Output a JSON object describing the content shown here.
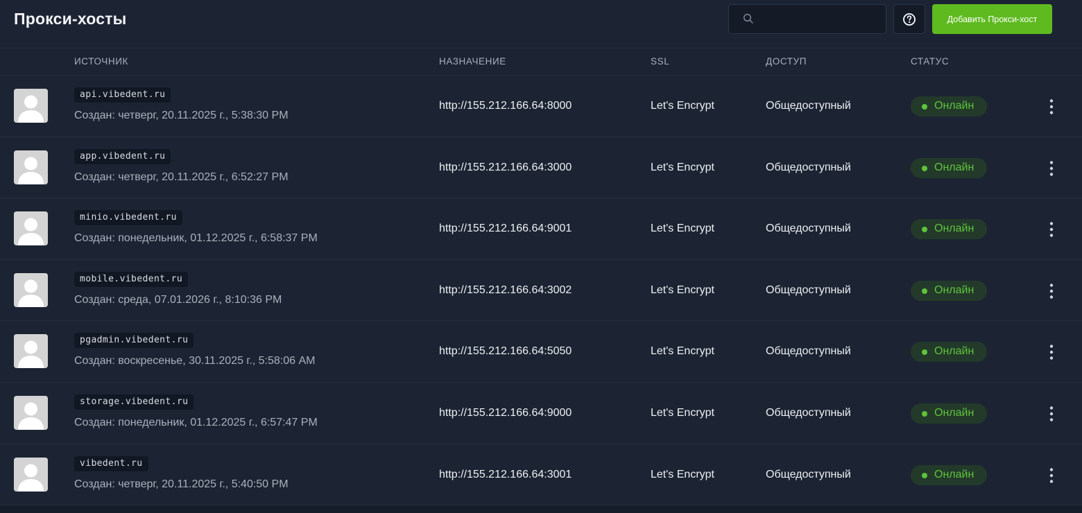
{
  "header": {
    "title": "Прокси-хосты",
    "search_placeholder": "",
    "search_value": "",
    "add_button_label": "Добавить Прокси-хост"
  },
  "columns": {
    "source": "ИСТОЧНИК",
    "destination": "НАЗНАЧЕНИЕ",
    "ssl": "SSL",
    "access": "ДОСТУП",
    "status": "СТАТУС"
  },
  "rows": [
    {
      "domain": "api.vibedent.ru",
      "created": "Создан: четверг, 20.11.2025 г., 5:38:30 PM",
      "destination": "http://155.212.166.64:8000",
      "ssl": "Let's Encrypt",
      "access": "Общедоступный",
      "status": "Онлайн"
    },
    {
      "domain": "app.vibedent.ru",
      "created": "Создан: четверг, 20.11.2025 г., 6:52:27 PM",
      "destination": "http://155.212.166.64:3000",
      "ssl": "Let's Encrypt",
      "access": "Общедоступный",
      "status": "Онлайн"
    },
    {
      "domain": "minio.vibedent.ru",
      "created": "Создан: понедельник, 01.12.2025 г., 6:58:37 PM",
      "destination": "http://155.212.166.64:9001",
      "ssl": "Let's Encrypt",
      "access": "Общедоступный",
      "status": "Онлайн"
    },
    {
      "domain": "mobile.vibedent.ru",
      "created": "Создан: среда, 07.01.2026 г., 8:10:36 PM",
      "destination": "http://155.212.166.64:3002",
      "ssl": "Let's Encrypt",
      "access": "Общедоступный",
      "status": "Онлайн"
    },
    {
      "domain": "pgadmin.vibedent.ru",
      "created": "Создан: воскресенье, 30.11.2025 г., 5:58:06 AM",
      "destination": "http://155.212.166.64:5050",
      "ssl": "Let's Encrypt",
      "access": "Общедоступный",
      "status": "Онлайн"
    },
    {
      "domain": "storage.vibedent.ru",
      "created": "Создан: понедельник, 01.12.2025 г., 6:57:47 PM",
      "destination": "http://155.212.166.64:9000",
      "ssl": "Let's Encrypt",
      "access": "Общедоступный",
      "status": "Онлайн"
    },
    {
      "domain": "vibedent.ru",
      "created": "Создан: четверг, 20.11.2025 г., 5:40:50 PM",
      "destination": "http://155.212.166.64:3001",
      "ssl": "Let's Encrypt",
      "access": "Общедоступный",
      "status": "Онлайн"
    }
  ],
  "icons": {
    "search": "search-icon",
    "help": "help-circle-icon",
    "avatar": "user-avatar-icon",
    "menu": "more-vertical-icon"
  },
  "colors": {
    "background": "#1c2433",
    "accent_green": "#5eba1f",
    "status_online": "#5fc33b"
  }
}
